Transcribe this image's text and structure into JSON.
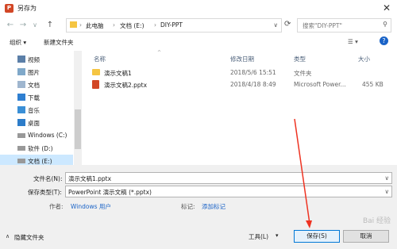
{
  "window": {
    "title": "另存为",
    "app_icon": "P"
  },
  "nav": {
    "back_icon": "←",
    "forward_icon": "→",
    "up_icon": "↑",
    "dropdown_icon": "∨",
    "breadcrumbs": [
      "此电脑",
      "文档 (E:)",
      "DIY-PPT"
    ],
    "separator": "›",
    "search_placeholder": "搜索\"DIY-PPT\""
  },
  "toolbar": {
    "organize": "组织 ▾",
    "new_folder": "新建文件夹"
  },
  "sidebar": {
    "items": [
      {
        "label": "视频",
        "icon": "video-icon"
      },
      {
        "label": "图片",
        "icon": "pictures-icon"
      },
      {
        "label": "文档",
        "icon": "documents-icon"
      },
      {
        "label": "下载",
        "icon": "downloads-icon"
      },
      {
        "label": "音乐",
        "icon": "music-icon"
      },
      {
        "label": "桌面",
        "icon": "desktop-icon"
      },
      {
        "label": "Windows (C:)",
        "icon": "drive-icon"
      },
      {
        "label": "软件 (D:)",
        "icon": "drive-icon"
      },
      {
        "label": "文档 (E:)",
        "icon": "drive-icon",
        "selected": true
      }
    ]
  },
  "columns": {
    "name": "名称",
    "modified": "修改日期",
    "type": "类型",
    "size": "大小"
  },
  "files": [
    {
      "name": "演示文稿1",
      "modified": "2018/5/6 15:51",
      "type": "文件夹",
      "size": "",
      "icon": "folder-icon"
    },
    {
      "name": "演示文稿2.pptx",
      "modified": "2018/4/18 8:49",
      "type": "Microsoft Power...",
      "size": "455 KB",
      "icon": "pptx-icon"
    }
  ],
  "form": {
    "filename_label": "文件名(N):",
    "filename_value": "演示文稿1.pptx",
    "filetype_label": "保存类型(T):",
    "filetype_value": "PowerPoint 演示文稿 (*.pptx)",
    "author_label": "作者:",
    "author_value": "Windows 用户",
    "tags_label": "标记:",
    "tags_value": "添加标记"
  },
  "footer": {
    "hide_folders": "隐藏文件夹",
    "tools": "工具(L)",
    "save": "保存(S)",
    "cancel": "取消"
  },
  "watermark": "Bai 经验"
}
